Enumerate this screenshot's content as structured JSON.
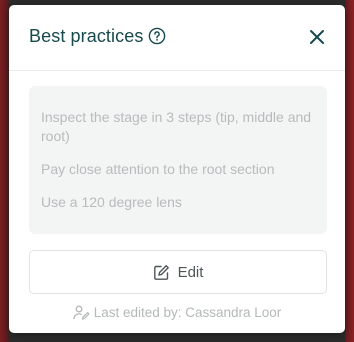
{
  "dialog": {
    "title": "Best practices",
    "help_icon": "help-circle-icon",
    "close_icon": "close-x-icon"
  },
  "tips": [
    "Inspect the stage in 3 steps (tip, middle and root)",
    "Pay close attention to the root section",
    "Use a 120 degree lens"
  ],
  "edit_button": {
    "label": "Edit",
    "icon": "pencil-square-icon"
  },
  "footer": {
    "text": "Last edited by: Cassandra Loor",
    "icon": "user-edit-icon"
  },
  "colors": {
    "title": "#17494d",
    "tip_text": "#b7bcbd",
    "content_bg": "#f3f4f4",
    "button_text": "#4e5657"
  }
}
